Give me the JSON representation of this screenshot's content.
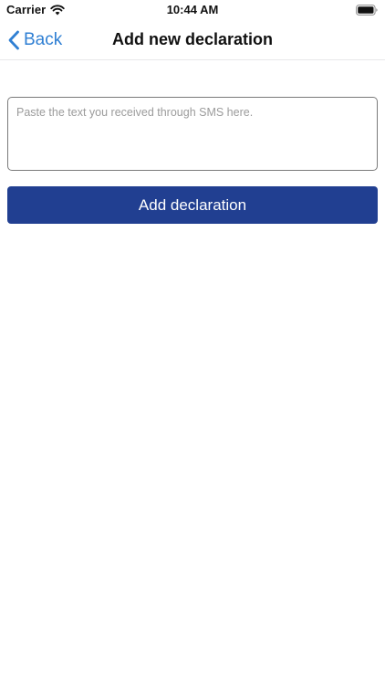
{
  "status_bar": {
    "carrier": "Carrier",
    "time": "10:44 AM",
    "wifi_icon": "wifi-icon",
    "battery_icon": "battery-icon"
  },
  "nav": {
    "back_label": "Back",
    "back_icon": "chevron-left-icon",
    "title": "Add new declaration"
  },
  "form": {
    "sms_input": {
      "placeholder": "Paste the text you received through SMS here.",
      "value": ""
    },
    "submit_label": "Add declaration"
  },
  "colors": {
    "accent_blue": "#2f7fd3",
    "button_blue": "#213f91",
    "input_border": "#7a7a7a",
    "placeholder": "#9b9b9b"
  }
}
